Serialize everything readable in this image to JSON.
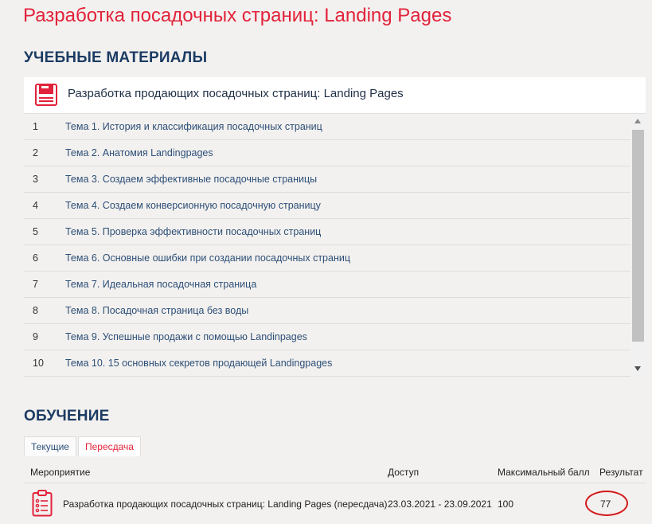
{
  "page_title": "Разработка посадочных страниц: Landing Pages",
  "materials": {
    "title": "УЧЕБНЫЕ МАТЕРИАЛЫ",
    "course_title": "Разработка продающих посадочных страниц: Landing Pages",
    "icon": "book-icon",
    "topics": [
      {
        "num": "1",
        "label": "Тема 1. История и классификация посадочных страниц"
      },
      {
        "num": "2",
        "label": "Тема 2. Анатомия Landingpages"
      },
      {
        "num": "3",
        "label": "Тема 3. Создаем эффективные посадочные страницы"
      },
      {
        "num": "4",
        "label": "Тема 4. Создаем конверсионную посадочную страницу"
      },
      {
        "num": "5",
        "label": "Тема 5. Проверка эффективности посадочных страниц"
      },
      {
        "num": "6",
        "label": "Тема 6. Основные ошибки при создании посадочных страниц"
      },
      {
        "num": "7",
        "label": "Тема 7. Идеальная посадочная страница"
      },
      {
        "num": "8",
        "label": "Тема 8. Посадочная страница без воды"
      },
      {
        "num": "9",
        "label": "Тема 9. Успешные продажи с помощью Landinpages"
      },
      {
        "num": "10",
        "label": "Тема 10. 15 основных секретов продающей Landingpages"
      }
    ]
  },
  "training": {
    "title": "ОБУЧЕНИЕ",
    "tabs": [
      {
        "label": "Текущие",
        "active": true
      },
      {
        "label": "Пересдача",
        "active": false
      }
    ],
    "columns": {
      "event": "Мероприятие",
      "access": "Доступ",
      "max_score": "Максимальный балл",
      "result": "Результат"
    },
    "rows": [
      {
        "icon": "clipboard-icon",
        "event": "Разработка продающих посадочных страниц: Landing Pages (пересдача)",
        "access": "23.03.2021 - 23.09.2021",
        "max_score": "100",
        "result": "77"
      }
    ]
  },
  "colors": {
    "accent_red": "#e2223a",
    "heading_blue": "#1b3b63",
    "link_blue": "#2c4f78",
    "background": "#f3f1ef"
  }
}
